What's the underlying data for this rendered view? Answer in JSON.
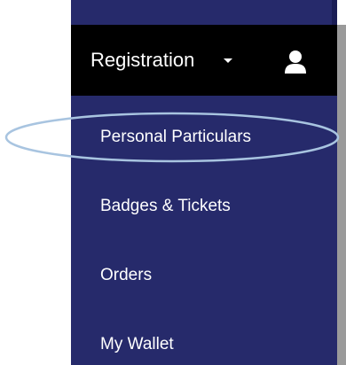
{
  "menu": {
    "header": {
      "label": "Registration",
      "caret_icon": "caret-down-icon",
      "user_icon": "user-icon"
    },
    "items": [
      {
        "label": "Personal Particulars"
      },
      {
        "label": "Badges & Tickets"
      },
      {
        "label": "Orders"
      },
      {
        "label": "My Wallet"
      }
    ]
  },
  "annotation": {
    "highlight_color": "#a8c4e0",
    "highlight_target": "Personal Particulars"
  },
  "colors": {
    "menu_background": "#262a6b",
    "header_background": "#000000",
    "text": "#ffffff"
  }
}
